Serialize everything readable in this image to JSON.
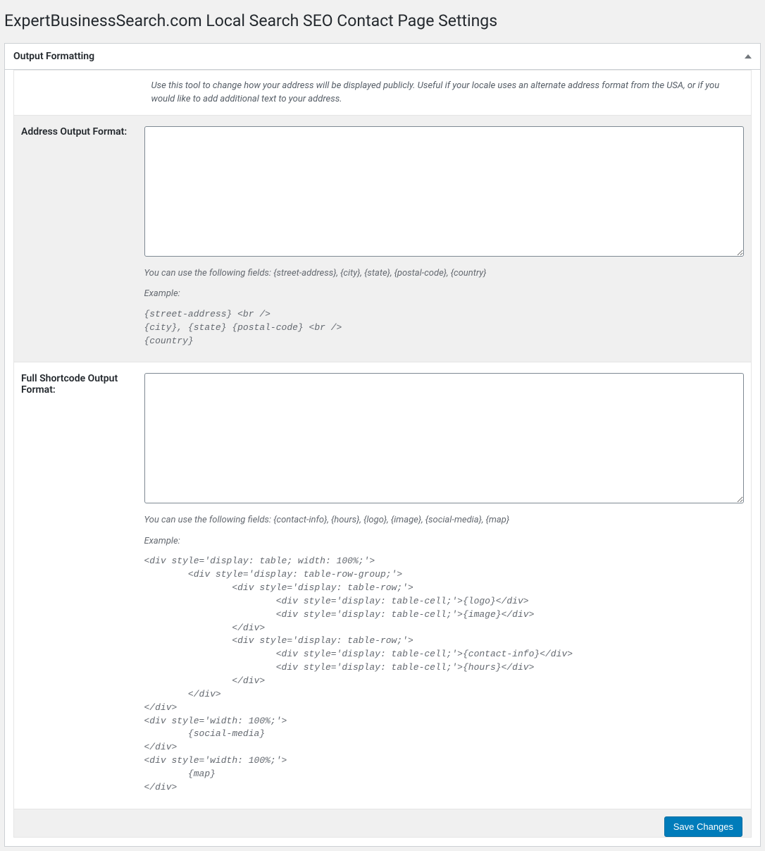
{
  "page": {
    "title": "ExpertBusinessSearch.com Local Search SEO Contact Page Settings"
  },
  "panel": {
    "title": "Output Formatting",
    "intro": "Use this tool to change how your address will be displayed publicly. Useful if your locale uses an alternate address format from the USA, or if you would like to add additional text to your address."
  },
  "fields": {
    "address_format": {
      "label": "Address Output Format:",
      "value": "",
      "help_fields": "You can use the following fields: {street-address}, {city}, {state}, {postal-code}, {country}",
      "example_label": "Example:",
      "example_code": "{street-address} <br />\n{city}, {state} {postal-code} <br />\n{country}"
    },
    "shortcode_format": {
      "label": "Full Shortcode Output Format:",
      "value": "",
      "help_fields": "You can use the following fields: {contact-info}, {hours}, {logo}, {image}, {social-media}, {map}",
      "example_label": "Example:",
      "example_code": "<div style='display: table; width: 100%;'>\n        <div style='display: table-row-group;'>\n                <div style='display: table-row;'>\n                        <div style='display: table-cell;'>{logo}</div>\n                        <div style='display: table-cell;'>{image}</div>\n                </div>\n                <div style='display: table-row;'>\n                        <div style='display: table-cell;'>{contact-info}</div>\n                        <div style='display: table-cell;'>{hours}</div>\n                </div>\n        </div>\n</div>\n<div style='width: 100%;'>\n        {social-media}\n</div>\n<div style='width: 100%;'>\n        {map}\n</div>"
    }
  },
  "actions": {
    "save_label": "Save Changes"
  }
}
